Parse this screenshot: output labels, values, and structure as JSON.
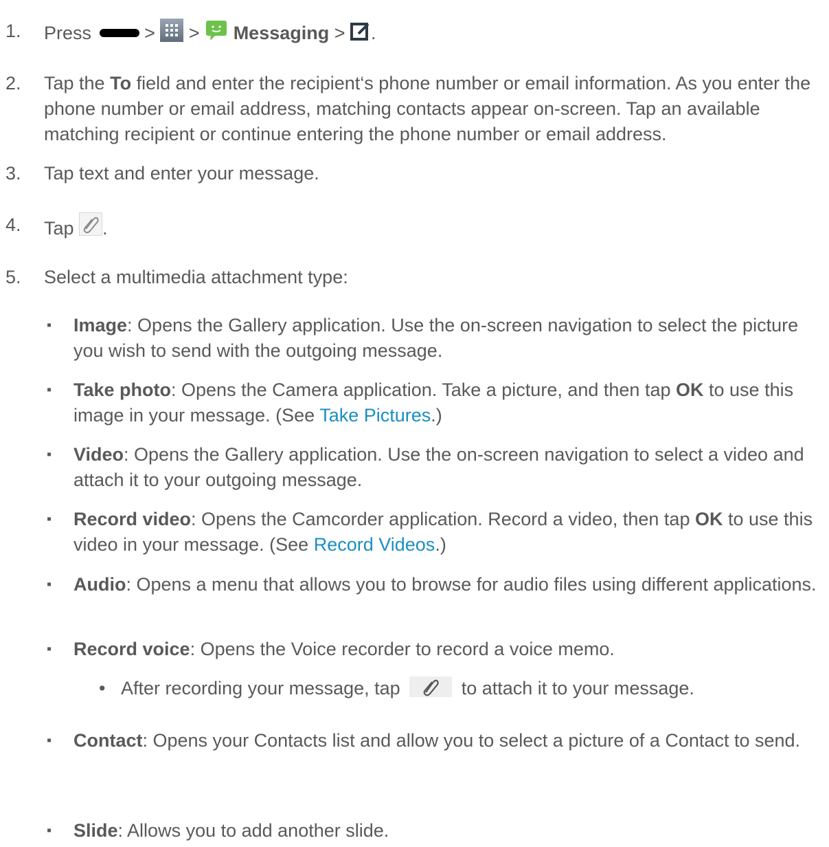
{
  "steps": {
    "s1": {
      "num": "1.",
      "press": "Press",
      "sep1": ">",
      "sep2": ">",
      "app": "Messaging",
      "sep3": ">",
      "end": "."
    },
    "s2": {
      "num": "2.",
      "pre": "Tap the",
      "bold": "To",
      "post": "field and enter the recipient‘s phone number or email information. As you enter the phone number or email address, matching contacts appear on-screen. Tap an available matching recipient or continue entering the phone number or email address."
    },
    "s3": {
      "num": "3.",
      "text": "Tap text and enter your message."
    },
    "s4": {
      "num": "4.",
      "text": "Tap",
      "end": "."
    },
    "s5": {
      "num": "5.",
      "text": "Select a multimedia attachment type:"
    }
  },
  "options": {
    "image": {
      "label": "Image",
      "text": ": Opens the Gallery application. Use the on-screen navigation to select the picture you wish to send with the outgoing message."
    },
    "take_photo": {
      "label": "Take photo",
      "text1": ": Opens the Camera application. Take a picture, and then tap",
      "ok": "OK",
      "text2": "to use this image in your message. (See",
      "link": "Take Pictures",
      "end": ".)"
    },
    "video": {
      "label": "Video",
      "text": ": Opens the Gallery application. Use the on-screen navigation to select a video and attach it to your outgoing message."
    },
    "record_video": {
      "label": "Record video",
      "text1": ": Opens the Camcorder application. Record a video, then tap",
      "ok": "OK",
      "text2": "to use this video in your message. (See",
      "link": "Record Videos",
      "end": ".)"
    },
    "audio": {
      "label": "Audio",
      "text": ": Opens a menu that allows you to browse for audio files using different applications."
    },
    "record_voice": {
      "label": "Record voice",
      "text": ": Opens the Voice recorder to record a voice memo."
    },
    "record_voice_sub": {
      "pre": "After recording your message, tap",
      "post": "to attach it to your message."
    },
    "contact": {
      "label": "Contact",
      "text": ": Opens your Contacts list and allow you to select a picture of a Contact to send."
    },
    "slide": {
      "label": "Slide",
      "text": ": Allows you to add another slide."
    }
  },
  "bullet_char": "▪",
  "dot_char": "•",
  "icons": [
    "home-key-icon",
    "apps-grid-icon",
    "messaging-app-icon",
    "compose-icon",
    "paperclip-icon"
  ],
  "colors": {
    "text": "#595959",
    "link": "#1a8fc0",
    "messaging_green": "#6cc24a"
  }
}
